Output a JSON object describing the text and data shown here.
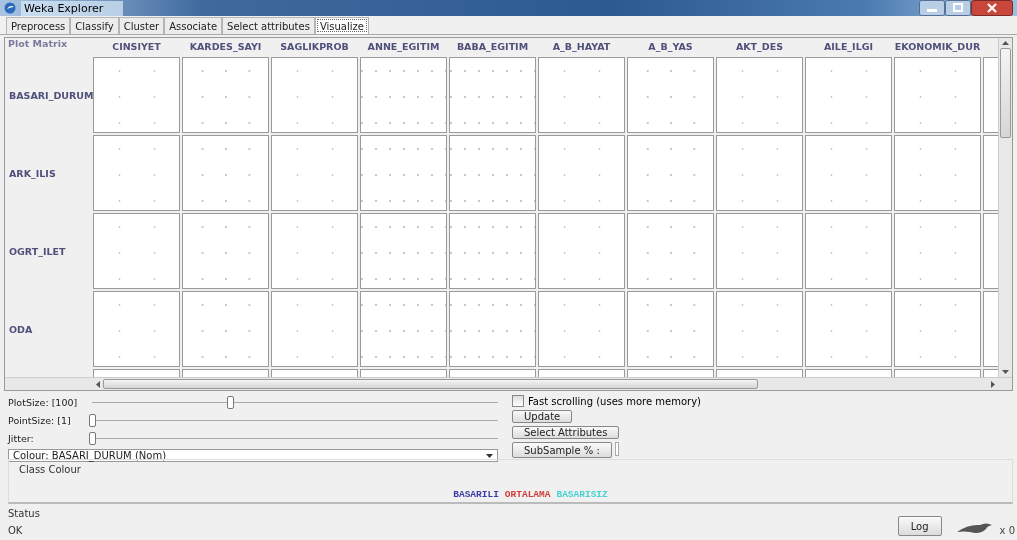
{
  "window": {
    "title": "Weka Explorer"
  },
  "tabs": [
    {
      "label": "Preprocess",
      "selected": false
    },
    {
      "label": "Classify",
      "selected": false
    },
    {
      "label": "Cluster",
      "selected": false
    },
    {
      "label": "Associate",
      "selected": false
    },
    {
      "label": "Select attributes",
      "selected": false
    },
    {
      "label": "Visualize",
      "selected": true
    }
  ],
  "plot_matrix": {
    "title": "Plot Matrix",
    "columns": [
      "CINSIYET",
      "KARDES_SAYI",
      "SAGLIKPROB",
      "ANNE_EGITIM",
      "BABA_EGITIM",
      "A_B_HAYAT",
      "A_B_YAS",
      "AKT_DES",
      "AILE_ILGI",
      "EKONOMIK_DUR"
    ],
    "rows": [
      "BASARI_DURUM",
      "ARK_ILIS",
      "OGRT_ILET",
      "ODA"
    ]
  },
  "controls": {
    "sliders": [
      {
        "label": "PlotSize: [100]",
        "level": 0.34
      },
      {
        "label": "PointSize: [1]",
        "level": 0
      },
      {
        "label": "Jitter:",
        "level": 0
      }
    ],
    "colour_dropdown": {
      "value": "Colour: BASARI_DURUM  (Nom)"
    },
    "fast_scrolling": {
      "label": "Fast scrolling (uses more memory)",
      "checked": false
    },
    "update_button": "Update",
    "select_attributes_button": "Select Attributes",
    "subsample_button": "SubSample % :"
  },
  "class_colour": {
    "title": "Class Colour",
    "classes": [
      {
        "label": "BASARILI",
        "color": "#3c3ca8"
      },
      {
        "label": "ORTALAMA",
        "color": "#d03c3c"
      },
      {
        "label": "BASARISIZ",
        "color": "#46d2d2"
      }
    ]
  },
  "status_bar": {
    "title": "Status",
    "message": "OK",
    "log_button": "Log",
    "count": "x 0"
  }
}
